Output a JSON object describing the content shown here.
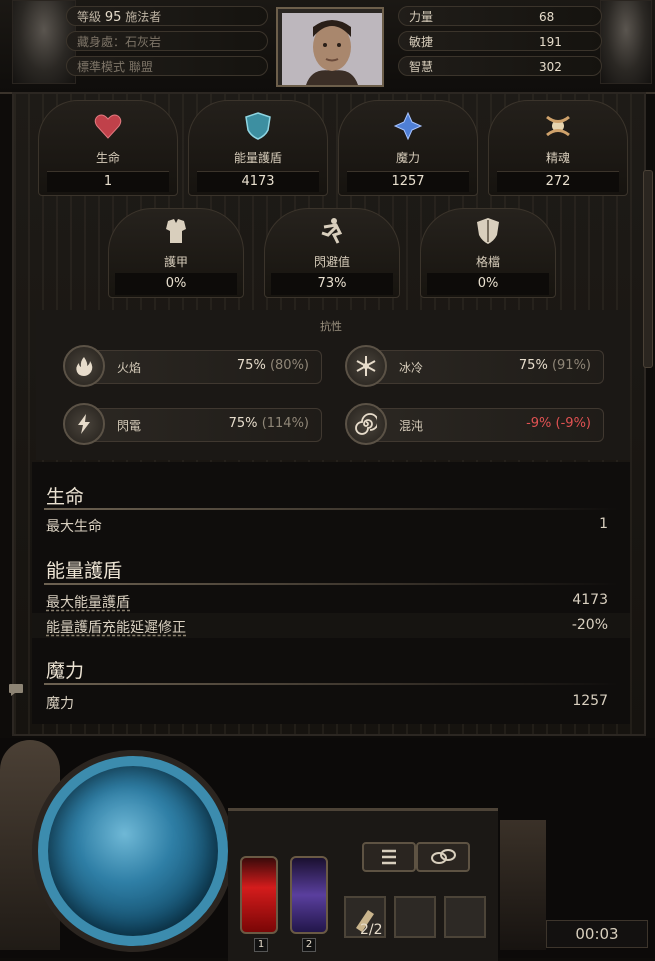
{
  "header": {
    "level_prefix": "等級",
    "level": "95",
    "char_class": "施法者",
    "hideout": "藏身處：石灰岩",
    "league": "標準模式 聯盟",
    "attributes": [
      {
        "label": "力量",
        "value": "68"
      },
      {
        "label": "敏捷",
        "value": "191"
      },
      {
        "label": "智慧",
        "value": "302"
      }
    ]
  },
  "main_stats": [
    {
      "label": "生命",
      "value": "1",
      "icon": "heart-icon",
      "color": "#c0414a"
    },
    {
      "label": "能量護盾",
      "value": "4173",
      "icon": "shield-icon",
      "color": "#5fb6c7"
    },
    {
      "label": "魔力",
      "value": "1257",
      "icon": "mana-icon",
      "color": "#4f7fd6"
    },
    {
      "label": "精魂",
      "value": "272",
      "icon": "spirit-icon",
      "color": "#d8c9a8"
    }
  ],
  "defences": [
    {
      "label": "護甲",
      "value": "0%",
      "icon": "armour-icon"
    },
    {
      "label": "閃避值",
      "value": "73%",
      "icon": "evasion-icon"
    },
    {
      "label": "格檔",
      "value": "0%",
      "icon": "block-icon"
    }
  ],
  "resistances": {
    "title": "抗性",
    "items": [
      {
        "label": "火焰",
        "value": "75%",
        "max": "(80%)",
        "icon": "fire-icon"
      },
      {
        "label": "冰冷",
        "value": "75%",
        "max": "(91%)",
        "icon": "cold-icon"
      },
      {
        "label": "閃電",
        "value": "75%",
        "max": "(114%)",
        "icon": "lightning-icon"
      },
      {
        "label": "混沌",
        "value": "-9%",
        "max": "(-9%)",
        "icon": "chaos-icon",
        "negative_color": "#e05252"
      }
    ]
  },
  "details": [
    {
      "heading": "生命",
      "rows": [
        {
          "label": "最大生命",
          "value": "1"
        }
      ]
    },
    {
      "heading": "能量護盾",
      "rows": [
        {
          "label": "最大能量護盾",
          "value": "4173"
        },
        {
          "label": "能量護盾充能延遲修正",
          "value": "-20%"
        }
      ]
    },
    {
      "heading": "魔力",
      "rows": [
        {
          "label": "魔力",
          "value": "1257"
        }
      ]
    }
  ],
  "hud": {
    "flask_1": "1",
    "flask_2": "2",
    "charges": "2/2",
    "timer": "00:03"
  }
}
